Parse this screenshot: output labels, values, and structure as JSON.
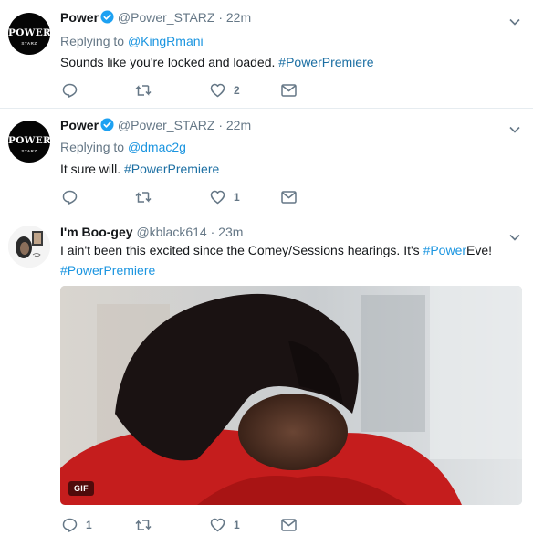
{
  "tweets": [
    {
      "name": "Power",
      "handle": "@Power_STARZ",
      "time": "22m",
      "replying_prefix": "Replying to ",
      "replying_to": "@KingRmani",
      "text": "Sounds like you're locked and loaded.",
      "hashtag": "#PowerPremiere",
      "reply_count": "",
      "retweet_count": "",
      "like_count": "2",
      "avatar_text": "POWER",
      "avatar_subtext": "STARZ"
    },
    {
      "name": "Power",
      "handle": "@Power_STARZ",
      "time": "22m",
      "replying_prefix": "Replying to ",
      "replying_to": "@dmac2g",
      "text": "It sure will.",
      "hashtag": "#PowerPremiere",
      "reply_count": "",
      "retweet_count": "",
      "like_count": "1",
      "avatar_text": "POWER",
      "avatar_subtext": "STARZ"
    },
    {
      "name": "I'm Boo-gey",
      "handle": "@kblack614",
      "time": "23m",
      "text_part1": "I ain't been this excited since the Comey/Sessions hearings. It's",
      "inline_hashtag": "#Power",
      "text_part2": "Eve!",
      "hashtag": "#PowerPremiere",
      "gif_label": "GIF",
      "reply_count": "1",
      "retweet_count": "",
      "like_count": "1"
    }
  ],
  "separator": "·",
  "colors": {
    "link": "#1b95e0",
    "secondary": "#657786",
    "verified": "#1da1f2"
  },
  "icons": [
    "verified-badge-icon",
    "chevron-down-icon",
    "reply-icon",
    "retweet-icon",
    "like-icon",
    "direct-message-icon"
  ]
}
